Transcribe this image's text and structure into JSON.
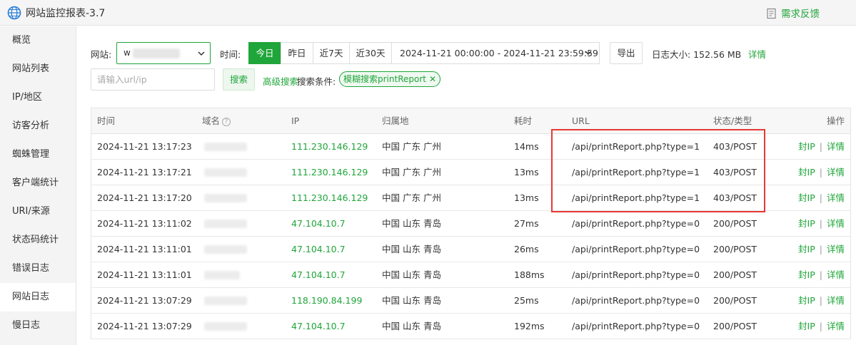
{
  "app": {
    "title": "网站监控报表-3.7",
    "feedback": "需求反馈"
  },
  "sidebar": {
    "items": [
      "概览",
      "网站列表",
      "IP/地区",
      "访客分析",
      "蜘蛛管理",
      "客户端统计",
      "URI/来源",
      "状态码统计",
      "错误日志",
      "网站日志",
      "慢日志"
    ],
    "active_index": 9
  },
  "filters": {
    "site_label": "网站:",
    "site_value": "w",
    "time_label": "时间:",
    "ranges": [
      "今日",
      "昨日",
      "近7天",
      "近30天"
    ],
    "active_range_index": 0,
    "datetime_range": "2024-11-21 00:00:00 - 2024-11-21 23:59:59",
    "export_label": "导出",
    "log_size_label": "日志大小: 152.56 MB",
    "details_label": "详情",
    "search_placeholder": "请输入url/ip",
    "search_button": "搜索",
    "advanced_search": "高级搜索",
    "search_conditions_label": "搜索条件:",
    "tag": "模糊搜索printReport"
  },
  "table": {
    "columns": [
      "时间",
      "域名",
      "IP",
      "归属地",
      "耗时",
      "URL",
      "状态/类型",
      "操作"
    ],
    "ban_ip_label": "封IP",
    "detail_label": "详情",
    "rows": [
      {
        "time": "2024-11-21 13:17:23",
        "ip": "111.230.146.129",
        "location": "中国 广东 广州",
        "duration": "14ms",
        "url": "/api/printReport.php?type=1",
        "status": "403/POST"
      },
      {
        "time": "2024-11-21 13:17:21",
        "ip": "111.230.146.129",
        "location": "中国 广东 广州",
        "duration": "13ms",
        "url": "/api/printReport.php?type=1",
        "status": "403/POST"
      },
      {
        "time": "2024-11-21 13:17:20",
        "ip": "111.230.146.129",
        "location": "中国 广东 广州",
        "duration": "13ms",
        "url": "/api/printReport.php?type=1",
        "status": "403/POST"
      },
      {
        "time": "2024-11-21 13:11:02",
        "ip": "47.104.10.7",
        "location": "中国 山东 青岛",
        "duration": "27ms",
        "url": "/api/printReport.php?type=0",
        "status": "200/POST"
      },
      {
        "time": "2024-11-21 13:11:01",
        "ip": "47.104.10.7",
        "location": "中国 山东 青岛",
        "duration": "26ms",
        "url": "/api/printReport.php?type=0",
        "status": "200/POST"
      },
      {
        "time": "2024-11-21 13:11:01",
        "ip": "47.104.10.7",
        "location": "中国 山东 青岛",
        "duration": "188ms",
        "url": "/api/printReport.php?type=0",
        "status": "200/POST"
      },
      {
        "time": "2024-11-21 13:07:29",
        "ip": "118.190.84.199",
        "location": "中国 山东 青岛",
        "duration": "25ms",
        "url": "/api/printReport.php?type=0",
        "status": "200/POST"
      },
      {
        "time": "2024-11-21 13:07:29",
        "ip": "47.104.10.7",
        "location": "中国 山东 青岛",
        "duration": "192ms",
        "url": "/api/printReport.php?type=0",
        "status": "200/POST"
      }
    ]
  },
  "colors": {
    "accent": "#20a53a",
    "highlight": "#e53935"
  }
}
